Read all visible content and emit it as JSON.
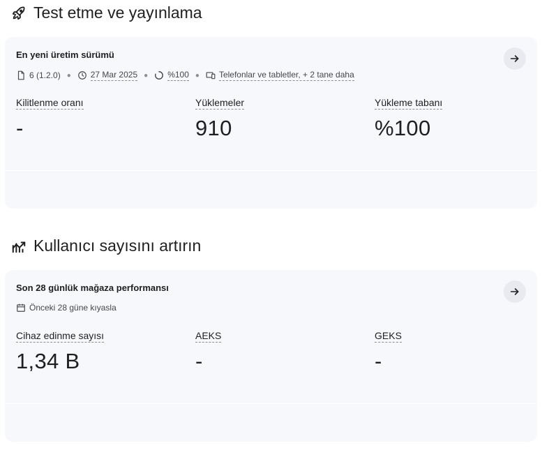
{
  "release": {
    "section_title": "Test etme ve yayınlama",
    "card": {
      "title": "En yeni üretim sürümü",
      "meta": {
        "version": "6 (1.2.0)",
        "date": "27 Mar 2025",
        "rollout": "%100",
        "devices": "Telefonlar ve tabletler, + 2 tane daha"
      },
      "metrics": [
        {
          "label": "Kilitlenme oranı",
          "value": "-"
        },
        {
          "label": "Yüklemeler",
          "value": "910"
        },
        {
          "label": "Yükleme tabanı",
          "value": "%100"
        }
      ]
    }
  },
  "growth": {
    "section_title": "Kullanıcı sayısını artırın",
    "card": {
      "title": "Son 28 günlük mağaza performansı",
      "meta": {
        "compare": "Önceki 28 güne kıyasla"
      },
      "metrics": [
        {
          "label": "Cihaz edinme sayısı",
          "value": "1,34 B"
        },
        {
          "label": "AEKS",
          "value": "-"
        },
        {
          "label": "GEKS",
          "value": "-"
        }
      ]
    }
  },
  "icons": {
    "release_section": "rocket-icon",
    "growth_section": "growth-chart-icon",
    "arrow": "arrow-right-icon",
    "version": "file-icon",
    "date": "clock-icon",
    "rollout": "progress-icon",
    "devices": "devices-icon",
    "compare": "calendar-icon"
  }
}
